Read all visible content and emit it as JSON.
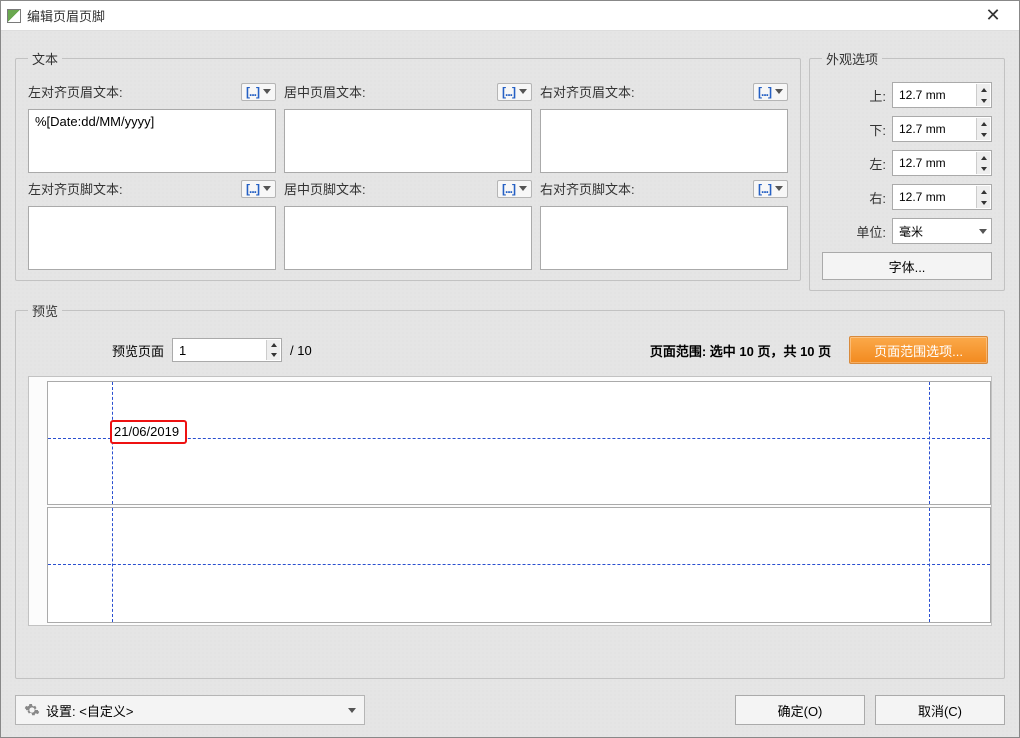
{
  "window": {
    "title": "编辑页眉页脚"
  },
  "sections": {
    "text": "文本",
    "appearance": "外观选项",
    "preview": "预览"
  },
  "fields": {
    "header_left_label": "左对齐页眉文本:",
    "header_center_label": "居中页眉文本:",
    "header_right_label": "右对齐页眉文本:",
    "footer_left_label": "左对齐页脚文本:",
    "footer_center_label": "居中页脚文本:",
    "footer_right_label": "右对齐页脚文本:",
    "header_left_value": "%[Date:dd/MM/yyyy]",
    "header_center_value": "",
    "header_right_value": "",
    "footer_left_value": "",
    "footer_center_value": "",
    "footer_right_value": "",
    "macro_button": "[...]"
  },
  "appearance": {
    "top_label": "上:",
    "bottom_label": "下:",
    "left_label": "左:",
    "right_label": "右:",
    "unit_label": "单位:",
    "top_value": "12.7 mm",
    "bottom_value": "12.7 mm",
    "left_value": "12.7 mm",
    "right_value": "12.7 mm",
    "unit_value": "毫米",
    "font_button": "字体..."
  },
  "preview": {
    "page_label": "预览页面",
    "page_value": "1",
    "slash": "/",
    "total": "10",
    "range_label": "页面范围: 选中 10 页，共 10 页",
    "range_button": "页面范围选项...",
    "rendered_date": "21/06/2019"
  },
  "bottom": {
    "settings_label": "设置:",
    "settings_value": "<自定义>",
    "ok": "确定(O)",
    "cancel": "取消(C)"
  }
}
